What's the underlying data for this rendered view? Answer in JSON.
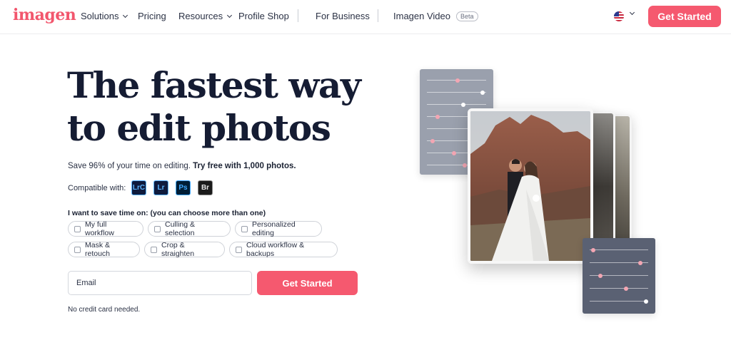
{
  "brand": {
    "name": "imagen",
    "color": "#f2566d"
  },
  "nav": {
    "items": [
      {
        "label": "Solutions",
        "has_dropdown": true
      },
      {
        "label": "Pricing",
        "has_dropdown": false
      },
      {
        "label": "Resources",
        "has_dropdown": true
      },
      {
        "label": "Profile Shop",
        "has_dropdown": false
      },
      {
        "label": "For Business",
        "has_dropdown": false
      },
      {
        "label": "Imagen Video",
        "has_dropdown": false,
        "badge": "Beta"
      }
    ],
    "language_icon": "us-flag-icon",
    "cta_label": "Get Started"
  },
  "hero": {
    "headline_line1": "The fastest way",
    "headline_line2": "to edit photos",
    "subtitle_plain": "Save 96% of your time on editing. ",
    "subtitle_bold": "Try free with 1,000 photos.",
    "compatible_label": "Compatible with:",
    "apps": [
      "LrC",
      "Lr",
      "Ps",
      "Br"
    ],
    "save_time_label": "I want to save time on: (you can choose more than one)",
    "options": [
      "My full workflow",
      "Culling & selection",
      "Personalized editing",
      "Mask & retouch",
      "Crop & straighten",
      "Cloud workflow & backups"
    ],
    "email_placeholder": "Email",
    "cta_label": "Get Started",
    "note": "No credit card needed."
  },
  "colors": {
    "accent": "#f5596f",
    "headline": "#151c33"
  }
}
